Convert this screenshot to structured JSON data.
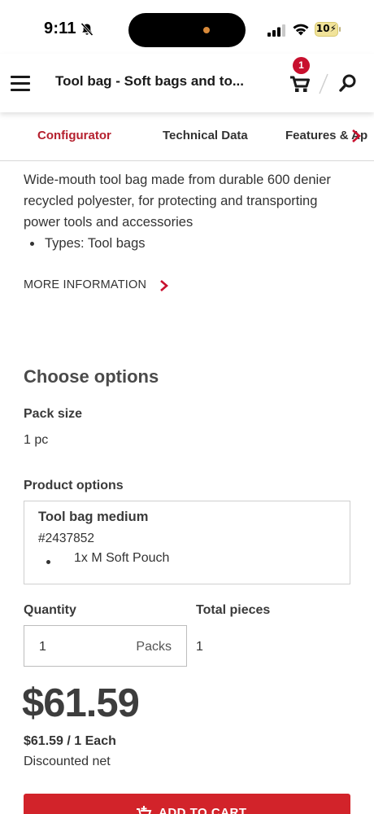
{
  "status_bar": {
    "time": "9:11",
    "battery": "10"
  },
  "header": {
    "title": "Tool bag - Soft bags and to...",
    "cart_count": "1"
  },
  "tabs": [
    {
      "label": "Configurator",
      "active": true
    },
    {
      "label": "Technical Data",
      "active": false
    },
    {
      "label": "Features & Ap",
      "active": false
    }
  ],
  "description": {
    "lines": [
      "Wide-mouth tool bag made from durable 600 denier",
      "recycled polyester, for protecting and transporting",
      "power tools and accessories"
    ],
    "bullets": [
      "Types: Tool bags"
    ]
  },
  "more_info_label": "MORE INFORMATION",
  "options": {
    "title": "Choose options",
    "pack_size_label": "Pack size",
    "pack_size_value": "1 pc",
    "product_options_label": "Product options",
    "product": {
      "name": "Tool bag medium",
      "sku": "#2437852",
      "features": [
        "1x M Soft Pouch"
      ]
    },
    "quantity_label": "Quantity",
    "quantity_value": "1",
    "quantity_unit": "Packs",
    "total_pieces_label": "Total pieces",
    "total_pieces_value": "1"
  },
  "pricing": {
    "price": "$61.59",
    "per_unit": "$61.59 / 1 Each",
    "note": "Discounted net"
  },
  "add_to_cart_label": "ADD TO CART",
  "colors": {
    "accent": "#b5202e",
    "button": "#d2232a",
    "badge": "#c8102e"
  }
}
